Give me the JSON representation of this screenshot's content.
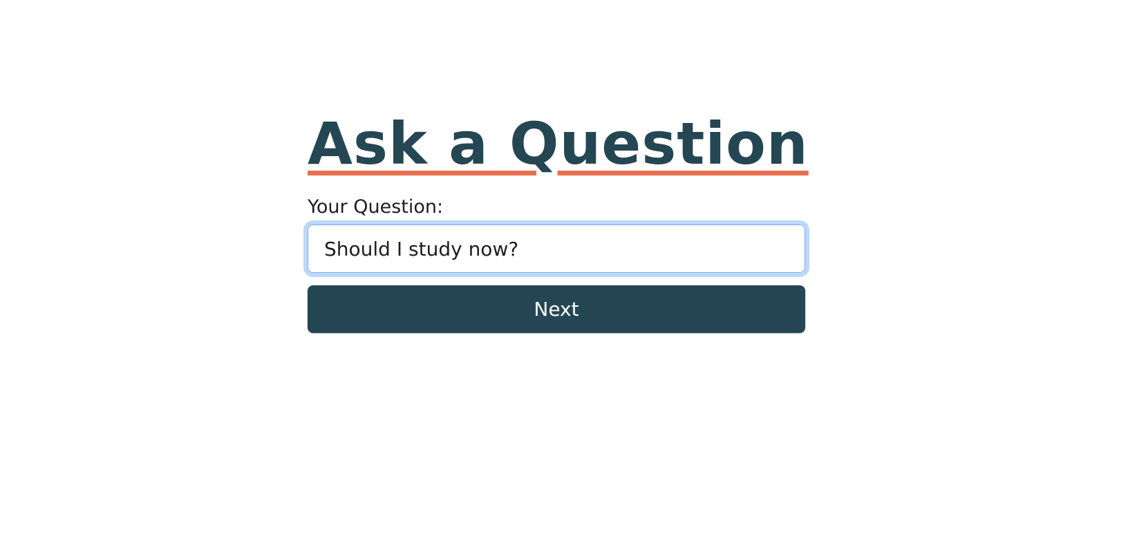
{
  "page": {
    "title": "Ask a Question"
  },
  "form": {
    "label": "Your Question:",
    "question_value": "Should I study now?",
    "next_label": "Next"
  },
  "colors": {
    "heading": "#254653",
    "underline_accent": "#e76f4f",
    "button_background": "#254653",
    "focus_ring": "#bcd8fb"
  }
}
